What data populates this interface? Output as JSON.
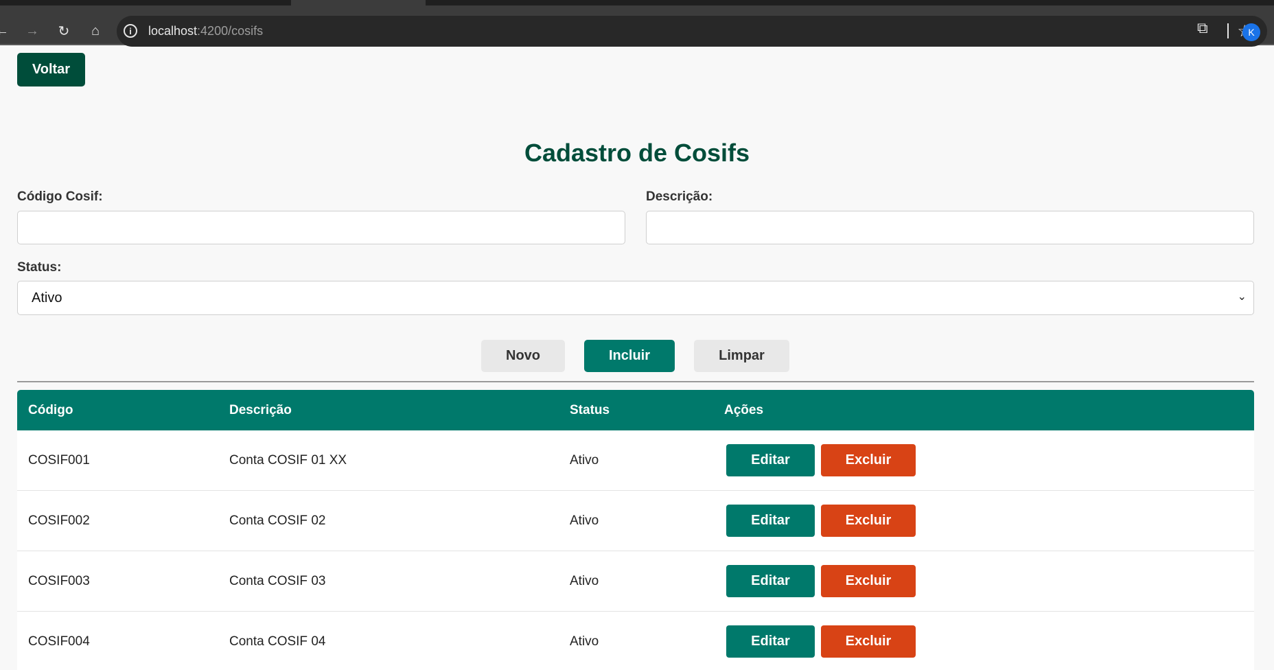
{
  "browser": {
    "url_host": "localhost",
    "url_path": ":4200/cosifs",
    "avatar_initial": "K"
  },
  "page": {
    "back_label": "Voltar",
    "title": "Cadastro de Cosifs"
  },
  "form": {
    "codigo_label": "Código Cosif:",
    "codigo_value": "",
    "descricao_label": "Descrição:",
    "descricao_value": "",
    "status_label": "Status:",
    "status_value": "Ativo"
  },
  "actions": {
    "novo_label": "Novo",
    "incluir_label": "Incluir",
    "limpar_label": "Limpar"
  },
  "table": {
    "headers": [
      "Código",
      "Descrição",
      "Status",
      "Ações"
    ],
    "edit_label": "Editar",
    "delete_label": "Excluir",
    "rows": [
      {
        "codigo": "COSIF001",
        "descricao": "Conta COSIF 01 XX",
        "status": "Ativo"
      },
      {
        "codigo": "COSIF002",
        "descricao": "Conta COSIF 02",
        "status": "Ativo"
      },
      {
        "codigo": "COSIF003",
        "descricao": "Conta COSIF 03",
        "status": "Ativo"
      },
      {
        "codigo": "COSIF004",
        "descricao": "Conta COSIF 04",
        "status": "Ativo"
      }
    ]
  },
  "colors": {
    "primary_dark": "#004d3a",
    "primary": "#00796b",
    "danger": "#d84315"
  }
}
